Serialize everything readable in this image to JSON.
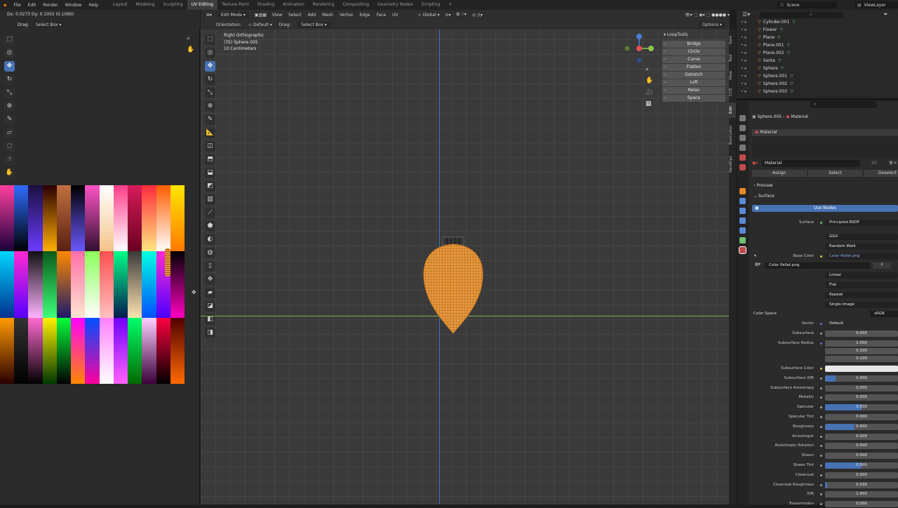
{
  "topbar": {
    "menus": [
      "File",
      "Edit",
      "Render",
      "Window",
      "Help"
    ],
    "workspaces": [
      "Layout",
      "Modeling",
      "Sculpting",
      "UV Editing",
      "Texture Paint",
      "Shading",
      "Animation",
      "Rendering",
      "Compositing",
      "Geometry Nodes",
      "Scripting"
    ],
    "active_workspace": "UV Editing",
    "add_tab": "+",
    "scene": "Scene",
    "view_layer": "ViewLayer"
  },
  "uv_editor": {
    "status": "Dx: 0.0273  Dy: 0.1055 (0.1090)",
    "drag_label": "Drag:",
    "drag_value": "Select Box"
  },
  "palette": {
    "rows": [
      [
        "#ff3fa0,#18003a",
        "#2f6cff,#000",
        "#1a1040,#6a3bff",
        "#2a0000,#ffae00",
        "#c07040,#5a2010",
        "#000,#6b58ff",
        "#ff54c6,#301030",
        "#ffffff,#f5c38a",
        "#ff3f8a,#ffffff",
        "#d61c5a,#6a0020",
        "#ff2b3a,#ffe680",
        "#ff5c00,#ffffff",
        "#ffe600,#ff7a00"
      ],
      [
        "#00d6ff,#003090",
        "#ff2bd0,#5800ff",
        "#111,#ffb3ff",
        "#0a5a1a,#3cff7a",
        "#ff8a00,#1a1a6a",
        "#ff6fa8,#ffe5d0",
        "#8bff5a,#ffffff",
        "#ff5050,#ffc0c0",
        "#00ff88,#001a50",
        "#3a3a3a,#ffe4b0",
        "#00ffe0,#0050ff",
        "#ff2ad4,#4a00ff",
        "#000,#ff00c0"
      ],
      [
        "#ff9a00,#2a0000",
        "#333,#000",
        "#ff6ad0,#000",
        "#fff000,#003a00",
        "#00ff3a,#000",
        "#ff00ff,#ff8800",
        "#0050ff,#ff00a0",
        "#ff80ff,#ffffff",
        "#7000ff,#ff60ff",
        "#00ff6a,#006a00",
        "#ffd0ff,#3a003a",
        "#ff0040,#000",
        "#500000,#ff6a00"
      ]
    ]
  },
  "viewport": {
    "mode": "Edit Mode",
    "menus": [
      "View",
      "Select",
      "Add",
      "Mesh",
      "Vertex",
      "Edge",
      "Face",
      "UV"
    ],
    "transform": "Global",
    "orientation_label": "Orientation:",
    "orientation_value": "Default",
    "drag_label": "Drag:",
    "drag_value": "Select Box",
    "options": "Options",
    "info_line1": "Right Orthographic",
    "info_line2": "(35) Sphere.005",
    "info_line3": "10 Centimeters",
    "axis_x": "X",
    "axis_y": "Y",
    "axis_z": "Z"
  },
  "looptools": {
    "title": "LoopTools",
    "buttons": [
      "Bridge",
      "Circle",
      "Curve",
      "Flatten",
      "Gstretch",
      "Loft",
      "Relax",
      "Space"
    ]
  },
  "side_tabs": [
    "Item",
    "Tool",
    "View",
    "CCD",
    "Edit",
    "BoxCutter",
    "HardOps"
  ],
  "outliner": {
    "items": [
      "Cylinder.001",
      "Flower",
      "Plane",
      "Plane.001",
      "Plane.002",
      "Santa",
      "Sphere",
      "Sphere.001",
      "Sphere.002",
      "Sphere.003"
    ]
  },
  "properties": {
    "breadcrumb_object": "Sphere.005",
    "breadcrumb_material": "Material",
    "slot_name": "Material",
    "material_name": "Material",
    "material_users": "20",
    "assign": "Assign",
    "select": "Select",
    "deselect": "Deselect",
    "preview": "Preview",
    "surface_panel": "Surface",
    "use_nodes": "Use Nodes",
    "surface_label": "Surface",
    "surface_value": "Principled BSDF",
    "distribution": "GGX",
    "subsurface_method": "Random Walk",
    "base_color_label": "Base Color",
    "base_color_value": "Color Pallet.png",
    "image_name": "Color Pallet.png",
    "image_users": "2",
    "interpolation": "Linear",
    "projection": "Flat",
    "extension": "Repeat",
    "source": "Single Image",
    "color_space_label": "Color Space",
    "color_space_value": "sRGB",
    "vector_label": "Vector",
    "vector_value": "Default",
    "subsurface_radius": [
      "1.000",
      "0.200",
      "0.100"
    ],
    "rows": [
      {
        "label": "Subsurface",
        "value": "0.000",
        "fill": 0
      },
      {
        "label": "Subsurface Radius",
        "value": "",
        "fill": 0
      },
      {
        "label": "Subsurface Color",
        "value": "",
        "fill": 0
      },
      {
        "label": "Subsurface IOR",
        "value": "1.400",
        "fill": 0.14
      },
      {
        "label": "Subsurface Anisotropy",
        "value": "0.000",
        "fill": 0
      },
      {
        "label": "Metallic",
        "value": "0.000",
        "fill": 0
      },
      {
        "label": "Specular",
        "value": "0.500",
        "fill": 0.5
      },
      {
        "label": "Specular Tint",
        "value": "0.000",
        "fill": 0
      },
      {
        "label": "Roughness",
        "value": "0.400",
        "fill": 0.4
      },
      {
        "label": "Anisotropic",
        "value": "0.000",
        "fill": 0
      },
      {
        "label": "Anisotropic Rotation",
        "value": "0.000",
        "fill": 0
      },
      {
        "label": "Sheen",
        "value": "0.000",
        "fill": 0
      },
      {
        "label": "Sheen Tint",
        "value": "0.500",
        "fill": 0.5
      },
      {
        "label": "Clearcoat",
        "value": "0.000",
        "fill": 0
      },
      {
        "label": "Clearcoat Roughness",
        "value": "0.030",
        "fill": 0.03
      },
      {
        "label": "IOR",
        "value": "1.450",
        "fill": 0
      },
      {
        "label": "Transmission",
        "value": "0.000",
        "fill": 0
      }
    ]
  },
  "colors": {
    "accent": "#4772b3",
    "selected_mesh": "#e8963a",
    "x_axis": "#e05050",
    "y_axis": "#8bc34a",
    "z_axis": "#4a7fd6"
  }
}
